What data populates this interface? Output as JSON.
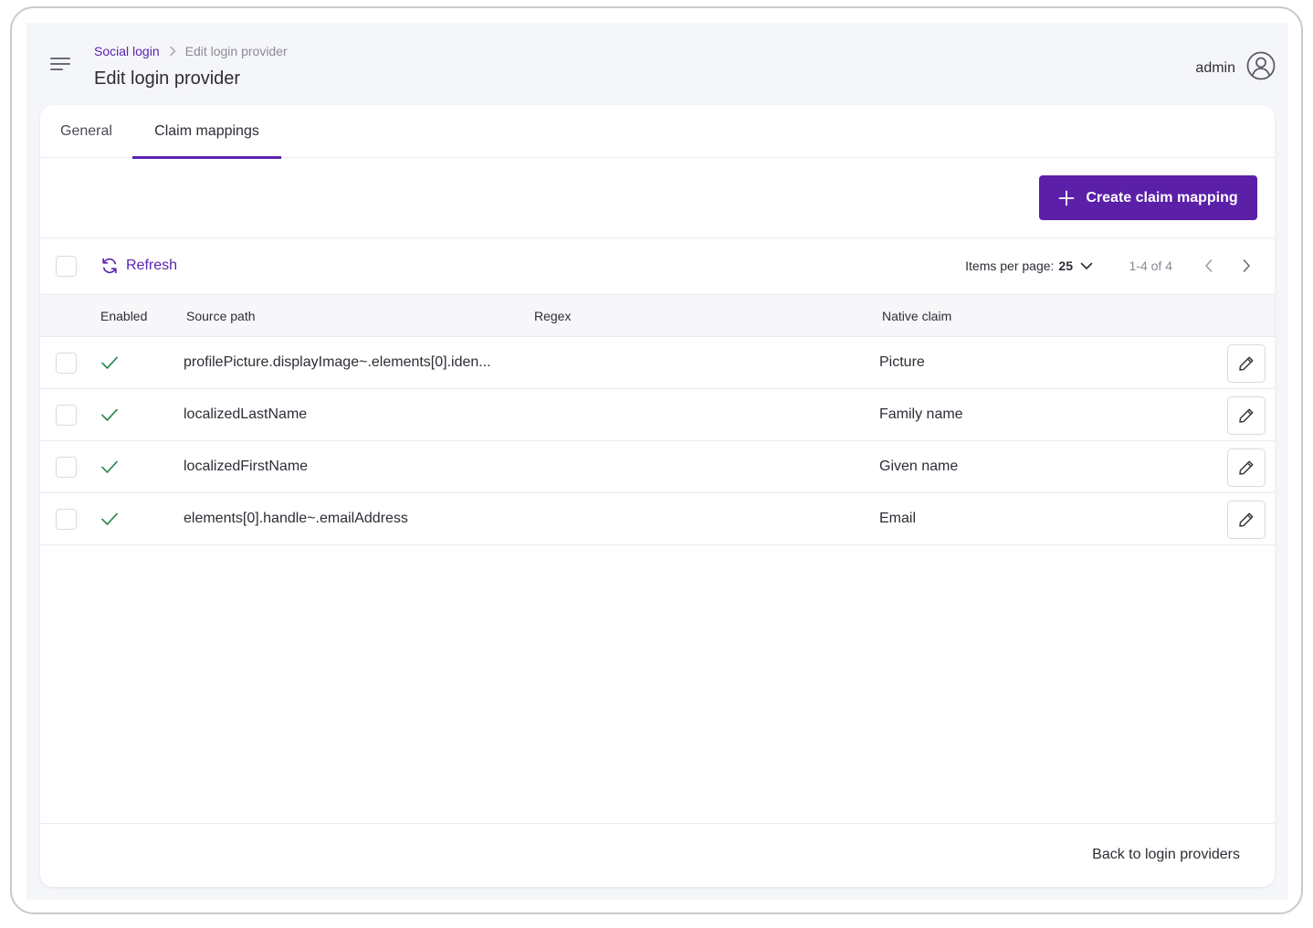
{
  "header": {
    "breadcrumb": {
      "parent": "Social login",
      "current": "Edit login provider"
    },
    "title": "Edit login provider",
    "user": {
      "name": "admin",
      "icon": "user-circle-icon"
    },
    "menu_icon": "menu-icon"
  },
  "tabs": [
    {
      "label": "General",
      "active": false
    },
    {
      "label": "Claim mappings",
      "active": true
    }
  ],
  "actions": {
    "create_label": "Create claim mapping",
    "create_icon": "plus-icon"
  },
  "toolbar": {
    "refresh_label": "Refresh",
    "items_per_page_label": "Items per page:",
    "items_per_page_value": "25",
    "range_label": "1-4 of 4"
  },
  "table": {
    "columns": [
      "Enabled",
      "Source path",
      "Regex",
      "Native claim"
    ],
    "rows": [
      {
        "enabled": true,
        "source_path": "profilePicture.displayImage~.elements[0].iden...",
        "regex": "",
        "native_claim": "Picture"
      },
      {
        "enabled": true,
        "source_path": "localizedLastName",
        "regex": "",
        "native_claim": "Family name"
      },
      {
        "enabled": true,
        "source_path": "localizedFirstName",
        "regex": "",
        "native_claim": "Given name"
      },
      {
        "enabled": true,
        "source_path": "elements[0].handle~.emailAddress",
        "regex": "",
        "native_claim": "Email"
      }
    ]
  },
  "footer": {
    "back_label": "Back to login providers"
  },
  "colors": {
    "accent": "#5b1fa8",
    "check": "#2e8b57",
    "background": "#f5f6fa"
  }
}
